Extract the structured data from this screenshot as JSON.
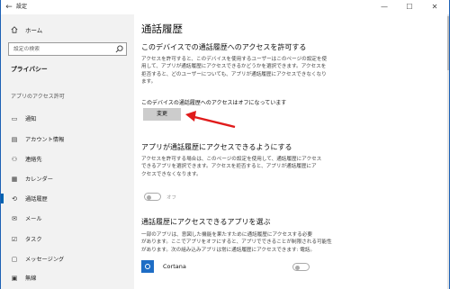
{
  "window": {
    "title": "設定",
    "controls": {
      "minimize": "—",
      "maximize": "☐",
      "close": "✕"
    },
    "back_glyph": "←"
  },
  "sidebar": {
    "home_label": "ホーム",
    "search_placeholder": "設定の検索",
    "section_title": "プライバシー",
    "permissions_heading": "アプリのアクセス許可",
    "items": [
      {
        "label": "通知",
        "icon": "notification-icon",
        "glyph": "▭"
      },
      {
        "label": "アカウント情報",
        "icon": "account-info-icon",
        "glyph": "▤"
      },
      {
        "label": "連絡先",
        "icon": "contacts-icon",
        "glyph": "⚇"
      },
      {
        "label": "カレンダー",
        "icon": "calendar-icon",
        "glyph": "▦"
      },
      {
        "label": "通話履歴",
        "icon": "call-history-icon",
        "glyph": "⟲",
        "selected": true
      },
      {
        "label": "メール",
        "icon": "mail-icon",
        "glyph": "✉"
      },
      {
        "label": "タスク",
        "icon": "tasks-icon",
        "glyph": "☑"
      },
      {
        "label": "メッセージング",
        "icon": "messaging-icon",
        "glyph": "▢"
      },
      {
        "label": "無線",
        "icon": "radio-icon",
        "glyph": "▣"
      }
    ]
  },
  "main": {
    "page_title": "通話履歴",
    "section1": {
      "heading": "このデバイスでの通話履歴へのアクセスを許可する",
      "lines": [
        "アクセスを許可すると、このデバイスを使用するユーザーはこのページの設定を使",
        "用して、アプリが通話履歴にアクセスできるかどうかを選択できます。アクセスを",
        "拒否すると、どのユーザーについても、アプリが通話履歴にアクセスできなくなり",
        "ます。"
      ],
      "status": "このデバイスの通話履歴へのアクセスはオフになっています",
      "button_label": "変更"
    },
    "section2": {
      "heading": "アプリが通話履歴にアクセスできるようにする",
      "lines": [
        "アクセスを許可する場合は、このページの設定を使用して、通話履歴にアクセス",
        "できるアプリを選択できます。アクセスを拒否すると、アプリが通話履歴にア",
        "クセスできなくなります。"
      ],
      "toggle_label": "オフ",
      "toggle_state": "off"
    },
    "section3": {
      "heading": "通話履歴にアクセスできるアプリを選ぶ",
      "lines": [
        "一部のアプリは、意図した機能を果たすために通話履歴にアクセスする必要",
        "があります。ここでアプリをオフにすると、アプリでできることが制限される可能性",
        "があります。次の組み込みアプリは常に通話履歴にアクセスできます: 電話。"
      ]
    },
    "apps": [
      {
        "name": "Cortana",
        "icon": "cortana-icon",
        "toggle_state": "off"
      }
    ]
  },
  "colors": {
    "accent": "#0063b1",
    "arrow": "#e01b1b",
    "sidebar_bg": "#f2f2f2"
  }
}
